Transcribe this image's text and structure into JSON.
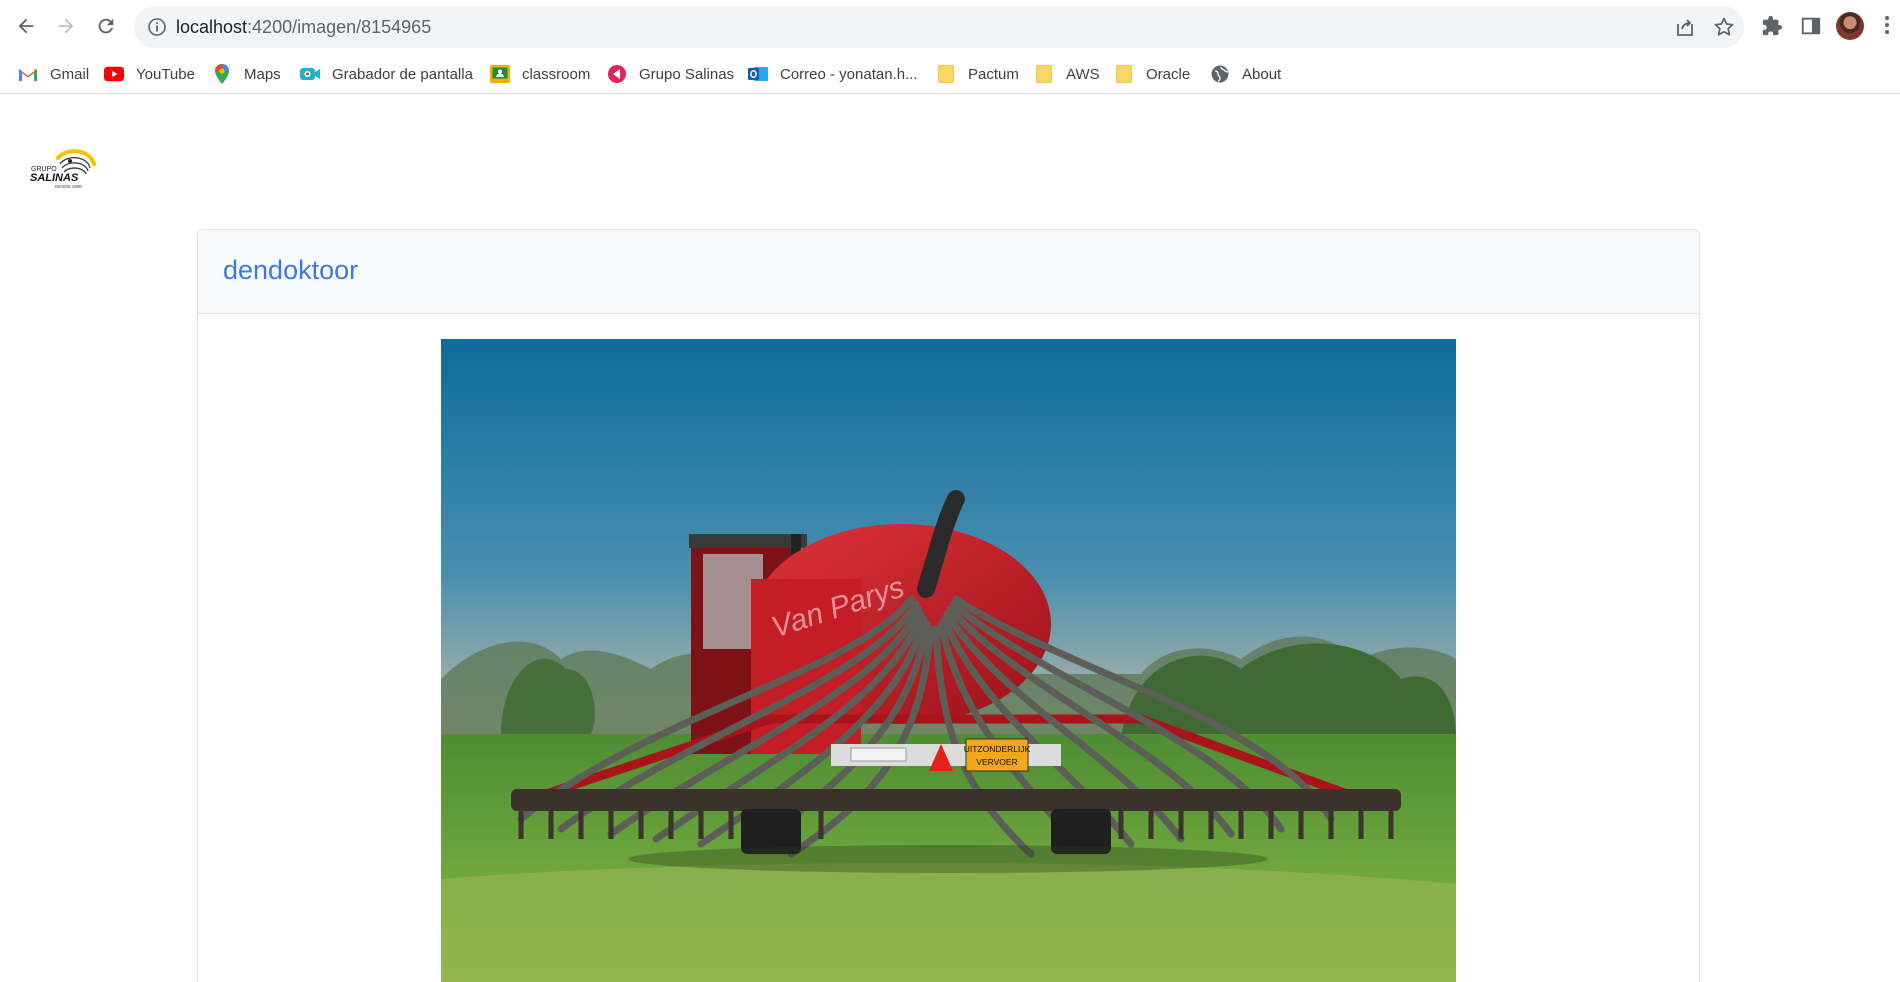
{
  "browser": {
    "url_host": "localhost",
    "url_path": ":4200/imagen/8154965"
  },
  "bookmarks": [
    {
      "label": "Gmail",
      "icon": "gmail-icon"
    },
    {
      "label": "YouTube",
      "icon": "youtube-icon"
    },
    {
      "label": "Maps",
      "icon": "maps-icon"
    },
    {
      "label": "Grabador de pantalla",
      "icon": "screen-recorder-icon"
    },
    {
      "label": "classroom",
      "icon": "classroom-icon"
    },
    {
      "label": "Grupo Salinas",
      "icon": "grupo-salinas-icon"
    },
    {
      "label": "Correo - yonatan.h...",
      "icon": "outlook-icon"
    },
    {
      "label": "Pactum",
      "icon": "folder-icon"
    },
    {
      "label": "AWS",
      "icon": "folder-icon"
    },
    {
      "label": "Oracle",
      "icon": "folder-icon"
    },
    {
      "label": "About",
      "icon": "globe-icon"
    }
  ],
  "page": {
    "logo_text": [
      "GRUPO",
      "SALINAS",
      "DESDE 1906"
    ],
    "title": "dendoktoor",
    "photo_sign_line1": "UITZONDERLIJK",
    "photo_sign_line2": "VERVOER",
    "photo_tank_text": "Van Parys"
  },
  "colors": {
    "accent": "#3a7be0",
    "header_bg": "#f8f9fa"
  }
}
